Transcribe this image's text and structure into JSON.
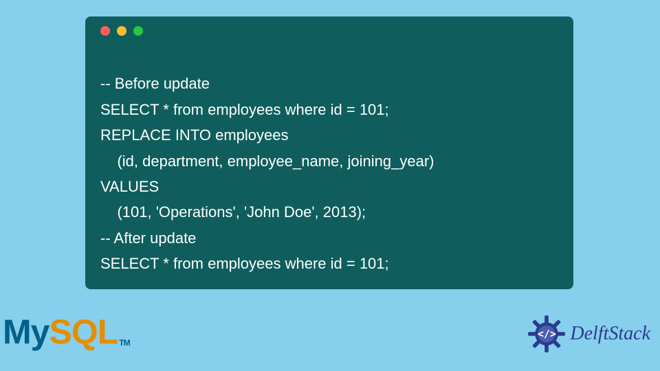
{
  "window": {
    "dots": [
      "red",
      "yellow",
      "green"
    ]
  },
  "code": {
    "lines": [
      "-- Before update",
      "SELECT * from employees where id = 101;",
      "REPLACE INTO employees",
      "    (id, department, employee_name, joining_year)",
      "VALUES",
      "    (101, 'Operations', 'John Doe', 2013);",
      "-- After update",
      "SELECT * from employees where id = 101;"
    ]
  },
  "logos": {
    "mysql_my": "My",
    "mysql_sql": "SQL",
    "mysql_tm": "TM",
    "delftstack": "DelftStack",
    "ds_code_glyph": "</>"
  },
  "colors": {
    "bg": "#86cfed",
    "window": "#0f5e5d",
    "mysql_blue": "#00618a",
    "mysql_orange": "#e48e00",
    "ds_blue": "#2b3b8f"
  }
}
